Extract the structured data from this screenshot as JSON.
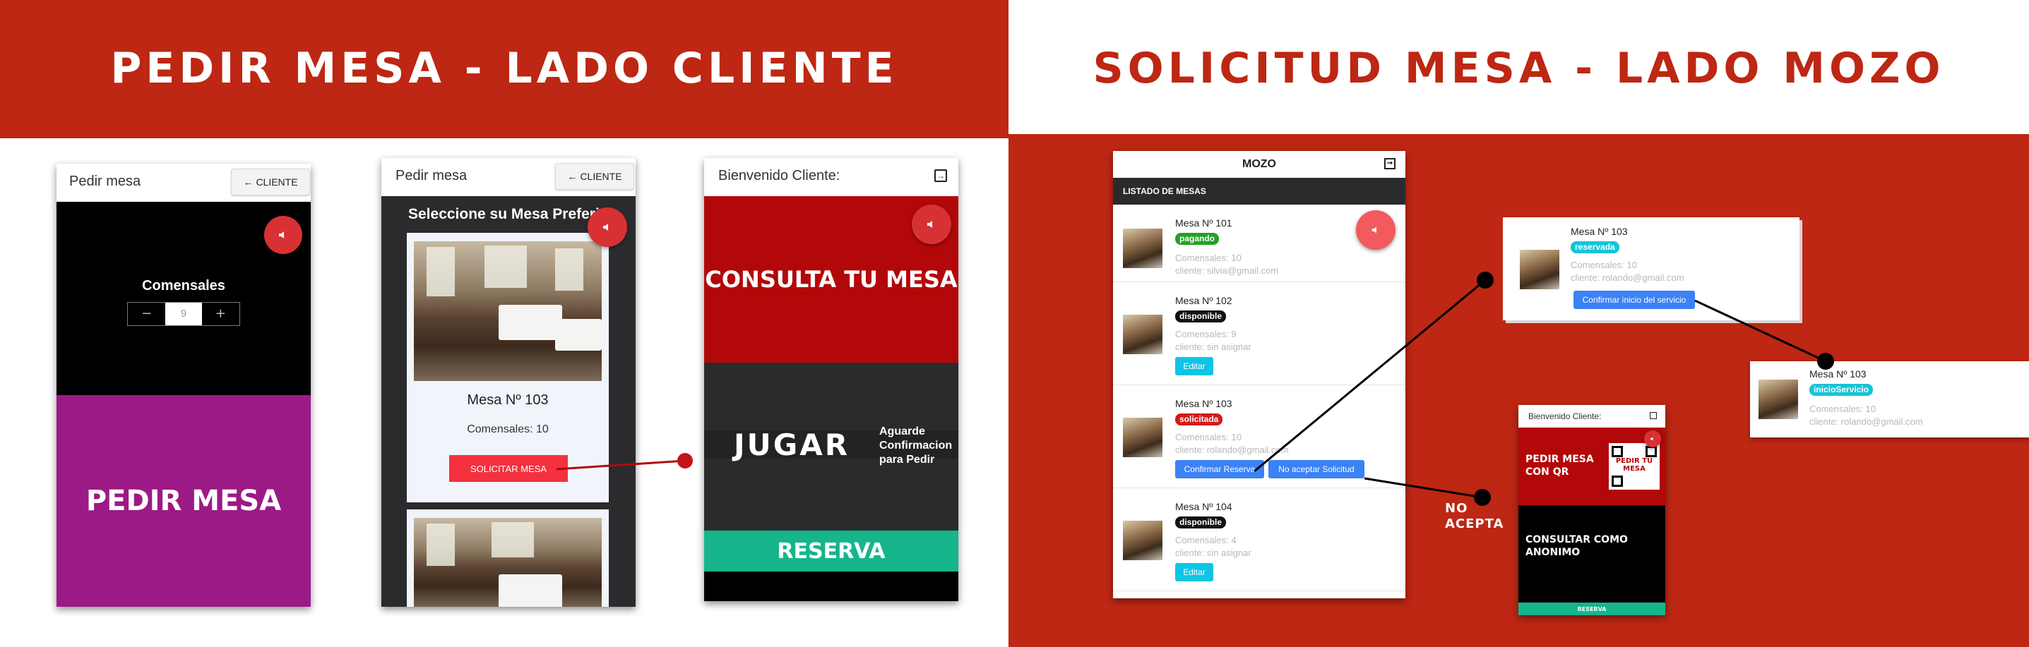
{
  "banners": {
    "left_title": "PEDIR MESA - LADO CLIENTE",
    "right_title": "SOLICITUD MESA - LADO MOZO"
  },
  "colors": {
    "brand_red": "#bd2713",
    "purple": "#9c1a86",
    "teal": "#16b58c",
    "dark": "#2b2b2d"
  },
  "screen1": {
    "appbar_title": "Pedir mesa",
    "back_button": "CLIENTE",
    "comensales_label": "Comensales",
    "stepper": {
      "minus": "−",
      "value": "9",
      "plus": "+"
    },
    "cta": "PEDIR MESA"
  },
  "screen2": {
    "appbar_title": "Pedir mesa",
    "back_button": "CLIENTE",
    "heading": "Seleccione su Mesa Preferida",
    "card": {
      "title": "Mesa Nº 103",
      "comensales": "Comensales: 10",
      "button": "SOLICITAR MESA"
    }
  },
  "screen3": {
    "appbar_title": "Bienvenido Cliente:",
    "consulta": "CONSULTA TU MESA",
    "jugar": "JUGAR",
    "aguarde": "Aguarde Confirmacion para Pedir",
    "reserva": "RESERVA"
  },
  "mozo": {
    "title": "MOZO",
    "section": "LISTADO DE MESAS",
    "rows": [
      {
        "title": "Mesa Nº 101",
        "status": "pagando",
        "status_color": "#1fa224",
        "comensales": "Comensales: 10",
        "cliente": "cliente: silvia@gmail.com"
      },
      {
        "title": "Mesa Nº 102",
        "status": "disponible",
        "status_color": "#111111",
        "comensales": "Comensales: 9",
        "cliente": "cliente: sin asignar",
        "button": "Editar"
      },
      {
        "title": "Mesa Nº 103",
        "status": "solicitada",
        "status_color": "#d21a1a",
        "comensales": "Comensales: 10",
        "cliente": "cliente: rolando@gmail.com",
        "confirm": "Confirmar Reserva",
        "reject": "No aceptar Solicitud"
      },
      {
        "title": "Mesa Nº 104",
        "status": "disponible",
        "status_color": "#111111",
        "comensales": "Comensales: 4",
        "cliente": "cliente: sin asignar",
        "button": "Editar"
      }
    ]
  },
  "result_reservada": {
    "title": "Mesa Nº 103",
    "status": "reservada",
    "comensales": "Comensales: 10",
    "cliente": "cliente: rolando@gmail.com",
    "button": "Confirmar inicio del servicio"
  },
  "result_inicio": {
    "title": "Mesa Nº 103",
    "status": "inicioServicio",
    "comensales": "Comensales: 10",
    "cliente": "cliente: rolando@gmail.com"
  },
  "no_acepta_label": "NO ACEPTA",
  "mini_screen": {
    "appbar_title": "Bienvenido Cliente:",
    "qr_option": "PEDIR MESA CON QR",
    "qr_text": "PEDIR TU MESA",
    "anon_option": "CONSULTAR COMO ANONIMO",
    "footer": "RESERVA"
  }
}
